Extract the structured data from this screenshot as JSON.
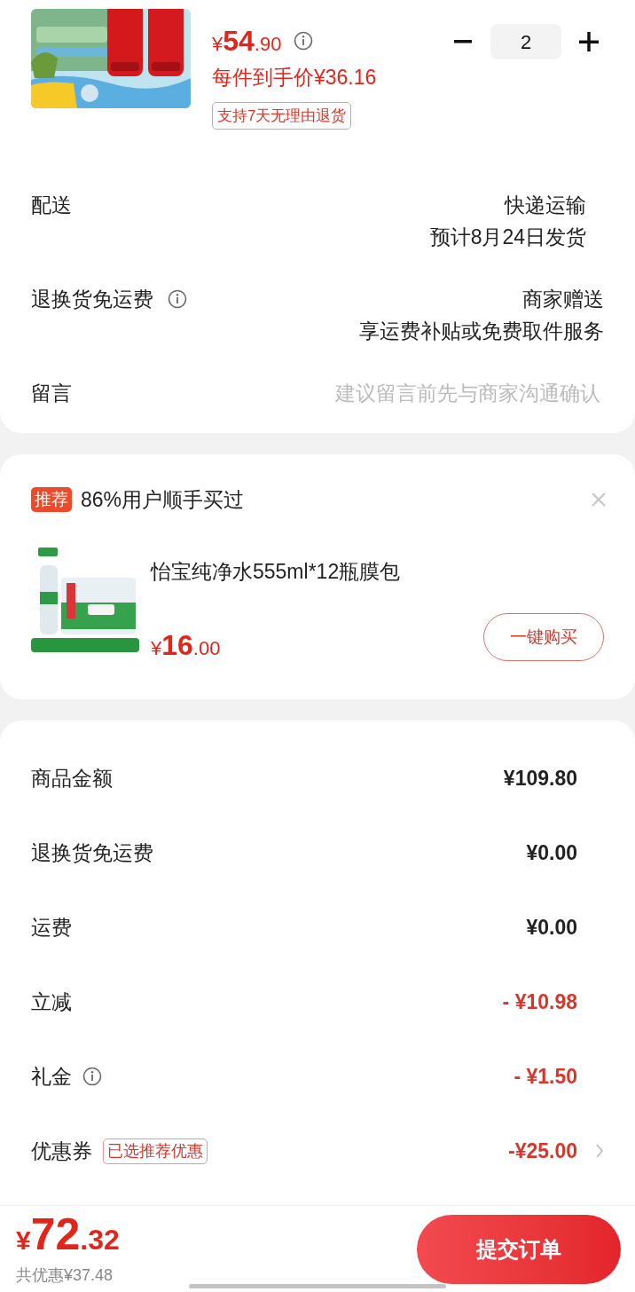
{
  "product": {
    "currency": "¥",
    "price_main": "54",
    "price_decimal": ".90",
    "unit_price": "每件到手价¥36.16",
    "return_badge": "支持7天无理由退货",
    "quantity": "2"
  },
  "details": [
    {
      "kind": "text",
      "label": "配送",
      "info": false,
      "values": [
        "快递运输",
        "预计8月24日发货"
      ]
    },
    {
      "kind": "text",
      "label": "退换货免运费",
      "info": true,
      "values": [
        "商家赠送",
        "享运费补贴或免费取件服务"
      ]
    },
    {
      "kind": "input",
      "label": "留言",
      "info": false,
      "placeholder": "建议留言前先与商家沟通确认"
    }
  ],
  "recommendation": {
    "tag": "推荐",
    "title": "86%用户顺手买过",
    "product_name": "怡宝纯净水555ml*12瓶膜包",
    "currency": "¥",
    "price_main": "16",
    "price_decimal": ".00",
    "buy_button": "一键购买"
  },
  "summary": [
    {
      "label": "商品金额",
      "info": false,
      "value": "¥109.80",
      "discount": false,
      "chevron": false
    },
    {
      "label": "退换货免运费",
      "info": false,
      "value": "¥0.00",
      "discount": false,
      "chevron": false
    },
    {
      "label": "运费",
      "info": false,
      "value": "¥0.00",
      "discount": false,
      "chevron": false
    },
    {
      "label": "立减",
      "info": false,
      "value": "- ¥10.98",
      "discount": true,
      "chevron": false
    },
    {
      "label": "礼金",
      "info": true,
      "value": "- ¥1.50",
      "discount": true,
      "chevron": false
    },
    {
      "label": "优惠券",
      "info": false,
      "badge": "已选推荐优惠",
      "value": "-¥25.00",
      "discount": true,
      "chevron": true
    }
  ],
  "footer": {
    "currency": "¥",
    "total_main": "72",
    "total_decimal": ".32",
    "savings": "共优惠¥37.48",
    "submit_button": "提交订单"
  }
}
